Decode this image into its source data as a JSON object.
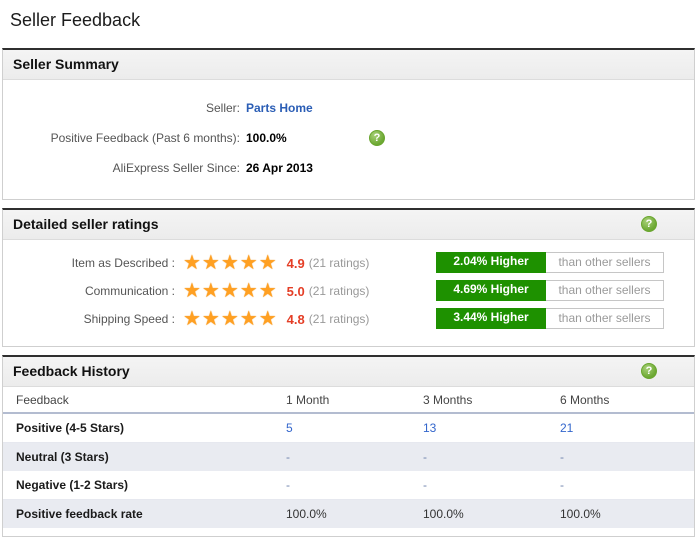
{
  "page": {
    "title": "Seller Feedback"
  },
  "icons": {
    "help": "?",
    "stars_full": "★★★★★"
  },
  "colors": {
    "badge_green": "#1e9100",
    "link_blue": "#3366cc",
    "star_orange": "#ffa022",
    "score_red": "#e43e26"
  },
  "seller_summary": {
    "header": "Seller Summary",
    "rows": [
      {
        "label": "Seller:",
        "value": "Parts Home"
      },
      {
        "label": "Positive Feedback (Past 6 months):",
        "value": "100.0%"
      },
      {
        "label": "AliExpress Seller Since:",
        "value": "26 Apr 2013"
      }
    ]
  },
  "detailed_ratings": {
    "header": "Detailed seller ratings",
    "rows": [
      {
        "label": "Item as Described :",
        "stars": "★★★★★",
        "score": "4.9",
        "count": "(21 ratings)",
        "badge": "2.04% Higher",
        "badge_suffix": "than other sellers"
      },
      {
        "label": "Communication :",
        "stars": "★★★★★",
        "score": "5.0",
        "count": "(21 ratings)",
        "badge": "4.69% Higher",
        "badge_suffix": "than other sellers"
      },
      {
        "label": "Shipping Speed :",
        "stars": "★★★★★",
        "score": "4.8",
        "count": "(21 ratings)",
        "badge": "3.44% Higher",
        "badge_suffix": "than other sellers"
      }
    ]
  },
  "feedback_history": {
    "header": "Feedback History",
    "columns": [
      "Feedback",
      "1 Month",
      "3 Months",
      "6 Months"
    ],
    "rows": [
      {
        "label": "Positive (4-5 Stars)",
        "values": [
          "5",
          "13",
          "21"
        ]
      },
      {
        "label": "Neutral (3 Stars)",
        "values": [
          "-",
          "-",
          "-"
        ]
      },
      {
        "label": "Negative (1-2 Stars)",
        "values": [
          "-",
          "-",
          "-"
        ]
      },
      {
        "label": "Positive feedback rate",
        "values": [
          "100.0%",
          "100.0%",
          "100.0%"
        ]
      }
    ]
  }
}
